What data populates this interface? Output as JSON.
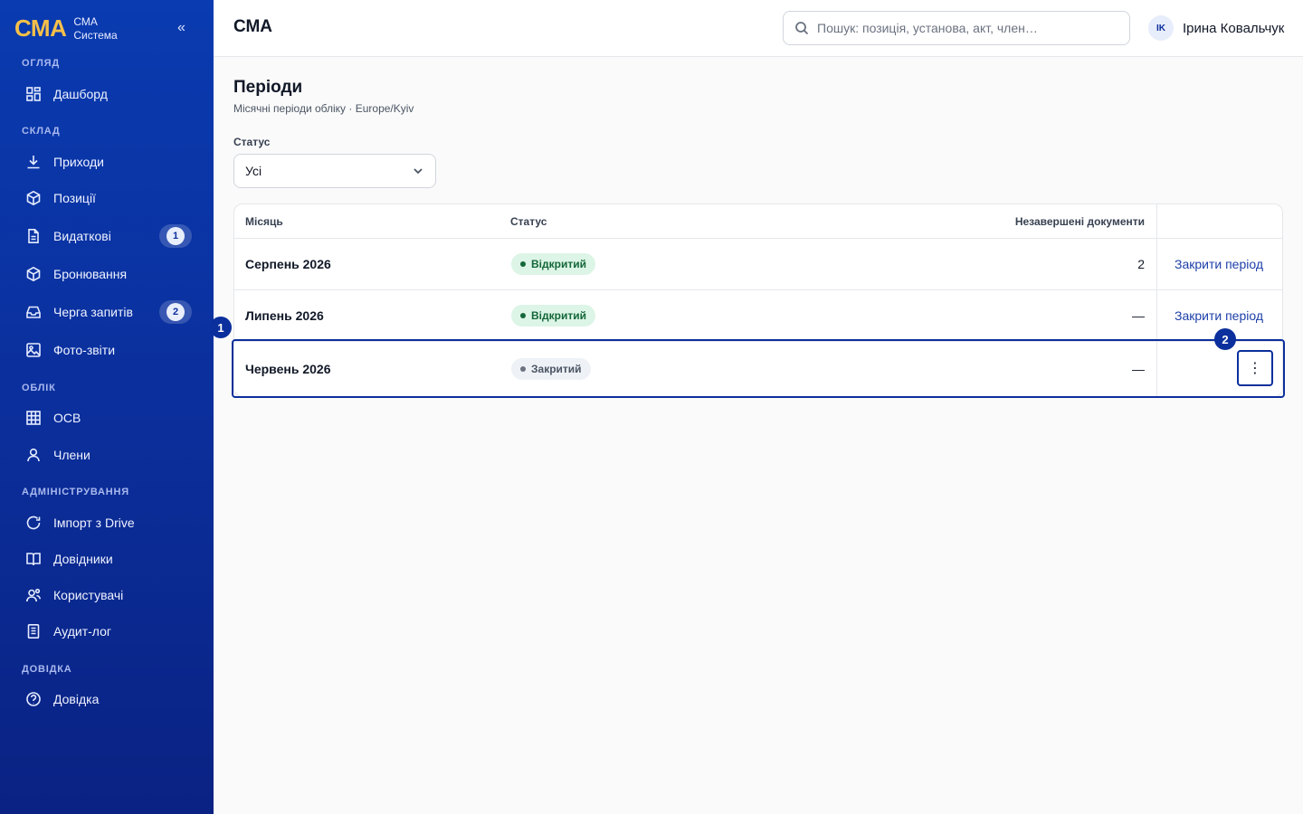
{
  "brand": {
    "logo": "СМА",
    "line1": "СМА",
    "line2": "Система",
    "collapse": "«"
  },
  "sidebar": {
    "sections": [
      {
        "label": "ОГЛЯД"
      },
      {
        "label": "СКЛАД"
      },
      {
        "label": "ОБЛІК"
      },
      {
        "label": "АДМІНІСТРУВАННЯ"
      },
      {
        "label": "ДОВІДКА"
      }
    ],
    "items": [
      {
        "label": "Дашборд",
        "icon": "dashboard-icon"
      },
      {
        "label": "Приходи",
        "icon": "download-icon"
      },
      {
        "label": "Позиції",
        "icon": "box-icon"
      },
      {
        "label": "Видаткові",
        "icon": "document-icon",
        "badge": "1"
      },
      {
        "label": "Бронювання",
        "icon": "box-icon"
      },
      {
        "label": "Черга запитів",
        "icon": "inbox-icon",
        "badge": "2"
      },
      {
        "label": "Фото-звіти",
        "icon": "image-icon"
      },
      {
        "label": "ОСВ",
        "icon": "table-icon"
      },
      {
        "label": "Члени",
        "icon": "user-icon"
      },
      {
        "label": "Імпорт з Drive",
        "icon": "refresh-icon"
      },
      {
        "label": "Довідники",
        "icon": "book-icon"
      },
      {
        "label": "Користувачі",
        "icon": "users-icon"
      },
      {
        "label": "Аудит-лог",
        "icon": "log-icon"
      },
      {
        "label": "Довідка",
        "icon": "help-icon"
      }
    ]
  },
  "header": {
    "title": "СМА",
    "search_placeholder": "Пошук: позиція, установа, акт, член…",
    "user_initials": "IK",
    "user_name": "Ірина Ковальчук"
  },
  "page": {
    "title": "Періоди",
    "subtitle": "Місячні періоди обліку · Europe/Kyiv",
    "filter_label": "Статус",
    "filter_value": "Усі"
  },
  "table": {
    "columns": [
      "Місяць",
      "Статус",
      "Незавершені документи"
    ],
    "rows": [
      {
        "month": "Серпень 2026",
        "status": "Відкритий",
        "status_type": "open",
        "pending": "2",
        "action": "Закрити період"
      },
      {
        "month": "Липень 2026",
        "status": "Відкритий",
        "status_type": "open",
        "pending": "—",
        "action": "Закрити період"
      },
      {
        "month": "Червень 2026",
        "status": "Закритий",
        "status_type": "closed",
        "pending": "—",
        "action": ""
      }
    ],
    "kebab": "⋮"
  },
  "markers": [
    "1",
    "2"
  ],
  "colors": {
    "sidebar": "#0b2f9c",
    "accent": "#0b2f9c",
    "brand_logo": "#f5c04a",
    "open_badge": "#dcf5e6",
    "closed_badge": "#eef1f6"
  }
}
